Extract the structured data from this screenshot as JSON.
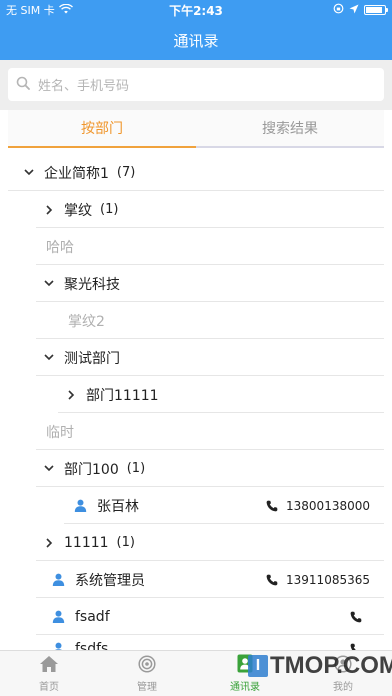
{
  "status": {
    "carrier": "无 SIM 卡",
    "time": "下午2:43"
  },
  "nav": {
    "title": "通讯录"
  },
  "search": {
    "placeholder": "姓名、手机号码"
  },
  "tabs": [
    {
      "label": "按部门"
    },
    {
      "label": "搜索结果"
    }
  ],
  "tree": {
    "r0": {
      "label": "企业简称1",
      "count": "(7)"
    },
    "r1": {
      "label": "掌纹",
      "count": "(1)"
    },
    "r2": {
      "label": "哈哈"
    },
    "r3": {
      "label": "聚光科技"
    },
    "r4": {
      "label": "掌纹2"
    },
    "r5": {
      "label": "测试部门"
    },
    "r6": {
      "label": "部门11111"
    },
    "r7": {
      "label": "临时"
    },
    "r8": {
      "label": "部门100",
      "count": "(1)"
    },
    "r9": {
      "label": "张百林",
      "phone": "13800138000"
    },
    "r10": {
      "label": "11111",
      "count": "(1)"
    },
    "r11": {
      "label": "系统管理员",
      "phone": "13911085365"
    },
    "r12": {
      "label": "fsadf"
    },
    "r13": {
      "label": "fsdfs"
    }
  },
  "bottom": [
    {
      "label": "首页",
      "icon": "home-icon"
    },
    {
      "label": "管理",
      "icon": "target-icon"
    },
    {
      "label": "通讯录",
      "icon": "contacts-icon"
    },
    {
      "label": "我的",
      "icon": "user-icon"
    }
  ],
  "watermark": {
    "text": "TMOP.COM",
    "badge": "I"
  },
  "colors": {
    "primary": "#3e9cf2",
    "tab_active": "#f0962c",
    "bottom_active": "#3aa23a",
    "person_icon": "#3e8fe0"
  }
}
